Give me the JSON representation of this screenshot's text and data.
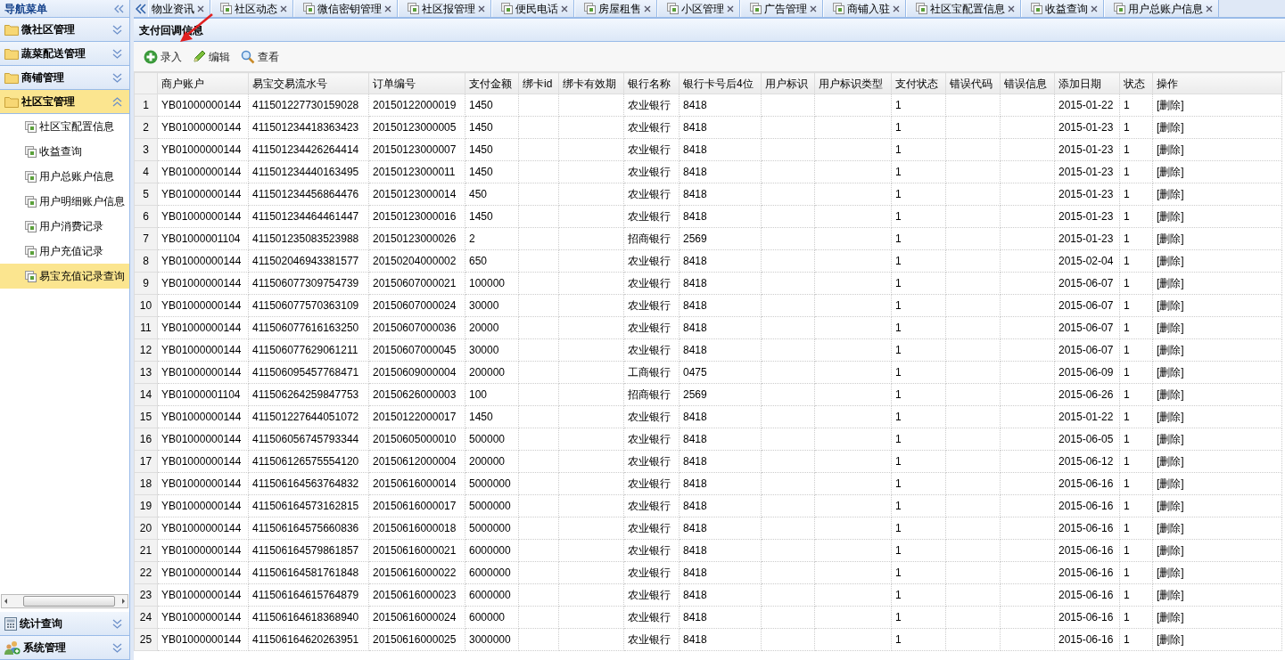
{
  "sidebar": {
    "title": "导航菜单",
    "sections": [
      {
        "label": "微社区管理",
        "kind": "folder",
        "expanded": false,
        "selected": false
      },
      {
        "label": "蔬菜配送管理",
        "kind": "folder",
        "expanded": false,
        "selected": false
      },
      {
        "label": "商铺管理",
        "kind": "folder",
        "expanded": false,
        "selected": false
      },
      {
        "label": "社区宝管理",
        "kind": "folder",
        "expanded": true,
        "selected": true,
        "items": [
          {
            "label": "社区宝配置信息",
            "selected": false
          },
          {
            "label": "收益查询",
            "selected": false
          },
          {
            "label": "用户总账户信息",
            "selected": false
          },
          {
            "label": "用户明细账户信息",
            "selected": false
          },
          {
            "label": "用户消费记录",
            "selected": false
          },
          {
            "label": "用户充值记录",
            "selected": false
          },
          {
            "label": "易宝充值记录查询",
            "selected": true
          }
        ]
      }
    ],
    "bottom_sections": [
      {
        "label": "统计查询",
        "kind": "calculator",
        "expanded": false
      },
      {
        "label": "系统管理",
        "kind": "users",
        "expanded": false
      }
    ]
  },
  "tabs": [
    {
      "label": "物业资讯",
      "kind": "cut",
      "selected": false
    },
    {
      "label": "社区动态",
      "kind": "page",
      "selected": false
    },
    {
      "label": "微信密钥管理",
      "kind": "page",
      "selected": false
    },
    {
      "label": "社区报管理",
      "kind": "page",
      "selected": false
    },
    {
      "label": "便民电话",
      "kind": "page",
      "selected": false
    },
    {
      "label": "房屋租售",
      "kind": "page",
      "selected": false
    },
    {
      "label": "小区管理",
      "kind": "page",
      "selected": false
    },
    {
      "label": "广告管理",
      "kind": "page",
      "selected": false
    },
    {
      "label": "商铺入驻",
      "kind": "page",
      "selected": false
    },
    {
      "label": "社区宝配置信息",
      "kind": "page",
      "selected": false
    },
    {
      "label": "收益查询",
      "kind": "page",
      "selected": false
    },
    {
      "label": "用户总账户信息",
      "kind": "page",
      "selected": false
    }
  ],
  "panel": {
    "title": "支付回调信息",
    "toolbar": [
      {
        "label": "录入",
        "kind": "add"
      },
      {
        "label": "编辑",
        "kind": "edit"
      },
      {
        "label": "查看",
        "kind": "view"
      }
    ],
    "table": {
      "columns": [
        "商户账户",
        "易宝交易流水号",
        "订单编号",
        "支付金额",
        "绑卡id",
        "绑卡有效期",
        "银行名称",
        "银行卡号后4位",
        "用户标识",
        "用户标识类型",
        "支付状态",
        "错误代码",
        "错误信息",
        "添加日期",
        "状态",
        "操作"
      ],
      "rows": [
        {
          "no": "1",
          "merchant_account": "YB01000000144",
          "serial_no": "411501227730159028",
          "order_no": "20150122000019",
          "amount": "1450",
          "bank": "农业银行",
          "card_last4": "8418",
          "pay_status": "1",
          "date": "2015-01-22",
          "status": "1",
          "action": "[删除]"
        },
        {
          "no": "2",
          "merchant_account": "YB01000000144",
          "serial_no": "411501234418363423",
          "order_no": "20150123000005",
          "amount": "1450",
          "bank": "农业银行",
          "card_last4": "8418",
          "pay_status": "1",
          "date": "2015-01-23",
          "status": "1",
          "action": "[删除]"
        },
        {
          "no": "3",
          "merchant_account": "YB01000000144",
          "serial_no": "411501234426264414",
          "order_no": "20150123000007",
          "amount": "1450",
          "bank": "农业银行",
          "card_last4": "8418",
          "pay_status": "1",
          "date": "2015-01-23",
          "status": "1",
          "action": "[删除]"
        },
        {
          "no": "4",
          "merchant_account": "YB01000000144",
          "serial_no": "411501234440163495",
          "order_no": "20150123000011",
          "amount": "1450",
          "bank": "农业银行",
          "card_last4": "8418",
          "pay_status": "1",
          "date": "2015-01-23",
          "status": "1",
          "action": "[删除]"
        },
        {
          "no": "5",
          "merchant_account": "YB01000000144",
          "serial_no": "411501234456864476",
          "order_no": "20150123000014",
          "amount": "450",
          "bank": "农业银行",
          "card_last4": "8418",
          "pay_status": "1",
          "date": "2015-01-23",
          "status": "1",
          "action": "[删除]"
        },
        {
          "no": "6",
          "merchant_account": "YB01000000144",
          "serial_no": "411501234464461447",
          "order_no": "20150123000016",
          "amount": "1450",
          "bank": "农业银行",
          "card_last4": "8418",
          "pay_status": "1",
          "date": "2015-01-23",
          "status": "1",
          "action": "[删除]"
        },
        {
          "no": "7",
          "merchant_account": "YB01000001104",
          "serial_no": "411501235083523988",
          "order_no": "20150123000026",
          "amount": "2",
          "bank": "招商银行",
          "card_last4": "2569",
          "pay_status": "1",
          "date": "2015-01-23",
          "status": "1",
          "action": "[删除]"
        },
        {
          "no": "8",
          "merchant_account": "YB01000000144",
          "serial_no": "411502046943381577",
          "order_no": "20150204000002",
          "amount": "650",
          "bank": "农业银行",
          "card_last4": "8418",
          "pay_status": "1",
          "date": "2015-02-04",
          "status": "1",
          "action": "[删除]"
        },
        {
          "no": "9",
          "merchant_account": "YB01000000144",
          "serial_no": "411506077309754739",
          "order_no": "20150607000021",
          "amount": "100000",
          "bank": "农业银行",
          "card_last4": "8418",
          "pay_status": "1",
          "date": "2015-06-07",
          "status": "1",
          "action": "[删除]"
        },
        {
          "no": "10",
          "merchant_account": "YB01000000144",
          "serial_no": "411506077570363109",
          "order_no": "20150607000024",
          "amount": "30000",
          "bank": "农业银行",
          "card_last4": "8418",
          "pay_status": "1",
          "date": "2015-06-07",
          "status": "1",
          "action": "[删除]"
        },
        {
          "no": "11",
          "merchant_account": "YB01000000144",
          "serial_no": "411506077616163250",
          "order_no": "20150607000036",
          "amount": "20000",
          "bank": "农业银行",
          "card_last4": "8418",
          "pay_status": "1",
          "date": "2015-06-07",
          "status": "1",
          "action": "[删除]"
        },
        {
          "no": "12",
          "merchant_account": "YB01000000144",
          "serial_no": "411506077629061211",
          "order_no": "20150607000045",
          "amount": "30000",
          "bank": "农业银行",
          "card_last4": "8418",
          "pay_status": "1",
          "date": "2015-06-07",
          "status": "1",
          "action": "[删除]"
        },
        {
          "no": "13",
          "merchant_account": "YB01000000144",
          "serial_no": "411506095457768471",
          "order_no": "20150609000004",
          "amount": "200000",
          "bank": "工商银行",
          "card_last4": "0475",
          "pay_status": "1",
          "date": "2015-06-09",
          "status": "1",
          "action": "[删除]"
        },
        {
          "no": "14",
          "merchant_account": "YB01000001104",
          "serial_no": "411506264259847753",
          "order_no": "20150626000003",
          "amount": "100",
          "bank": "招商银行",
          "card_last4": "2569",
          "pay_status": "1",
          "date": "2015-06-26",
          "status": "1",
          "action": "[删除]"
        },
        {
          "no": "15",
          "merchant_account": "YB01000000144",
          "serial_no": "411501227644051072",
          "order_no": "20150122000017",
          "amount": "1450",
          "bank": "农业银行",
          "card_last4": "8418",
          "pay_status": "1",
          "date": "2015-01-22",
          "status": "1",
          "action": "[删除]"
        },
        {
          "no": "16",
          "merchant_account": "YB01000000144",
          "serial_no": "411506056745793344",
          "order_no": "20150605000010",
          "amount": "500000",
          "bank": "农业银行",
          "card_last4": "8418",
          "pay_status": "1",
          "date": "2015-06-05",
          "status": "1",
          "action": "[删除]"
        },
        {
          "no": "17",
          "merchant_account": "YB01000000144",
          "serial_no": "411506126575554120",
          "order_no": "20150612000004",
          "amount": "200000",
          "bank": "农业银行",
          "card_last4": "8418",
          "pay_status": "1",
          "date": "2015-06-12",
          "status": "1",
          "action": "[删除]"
        },
        {
          "no": "18",
          "merchant_account": "YB01000000144",
          "serial_no": "411506164563764832",
          "order_no": "20150616000014",
          "amount": "5000000",
          "bank": "农业银行",
          "card_last4": "8418",
          "pay_status": "1",
          "date": "2015-06-16",
          "status": "1",
          "action": "[删除]"
        },
        {
          "no": "19",
          "merchant_account": "YB01000000144",
          "serial_no": "411506164573162815",
          "order_no": "20150616000017",
          "amount": "5000000",
          "bank": "农业银行",
          "card_last4": "8418",
          "pay_status": "1",
          "date": "2015-06-16",
          "status": "1",
          "action": "[删除]"
        },
        {
          "no": "20",
          "merchant_account": "YB01000000144",
          "serial_no": "411506164575660836",
          "order_no": "20150616000018",
          "amount": "5000000",
          "bank": "农业银行",
          "card_last4": "8418",
          "pay_status": "1",
          "date": "2015-06-16",
          "status": "1",
          "action": "[删除]"
        },
        {
          "no": "21",
          "merchant_account": "YB01000000144",
          "serial_no": "411506164579861857",
          "order_no": "20150616000021",
          "amount": "6000000",
          "bank": "农业银行",
          "card_last4": "8418",
          "pay_status": "1",
          "date": "2015-06-16",
          "status": "1",
          "action": "[删除]"
        },
        {
          "no": "22",
          "merchant_account": "YB01000000144",
          "serial_no": "411506164581761848",
          "order_no": "20150616000022",
          "amount": "6000000",
          "bank": "农业银行",
          "card_last4": "8418",
          "pay_status": "1",
          "date": "2015-06-16",
          "status": "1",
          "action": "[删除]"
        },
        {
          "no": "23",
          "merchant_account": "YB01000000144",
          "serial_no": "411506164615764879",
          "order_no": "20150616000023",
          "amount": "6000000",
          "bank": "农业银行",
          "card_last4": "8418",
          "pay_status": "1",
          "date": "2015-06-16",
          "status": "1",
          "action": "[删除]"
        },
        {
          "no": "24",
          "merchant_account": "YB01000000144",
          "serial_no": "411506164618368940",
          "order_no": "20150616000024",
          "amount": "600000",
          "bank": "农业银行",
          "card_last4": "8418",
          "pay_status": "1",
          "date": "2015-06-16",
          "status": "1",
          "action": "[删除]"
        },
        {
          "no": "25",
          "merchant_account": "YB01000000144",
          "serial_no": "411506164620263951",
          "order_no": "20150616000025",
          "amount": "3000000",
          "bank": "农业银行",
          "card_last4": "8418",
          "pay_status": "1",
          "date": "2015-06-16",
          "status": "1",
          "action": "[删除]"
        }
      ]
    }
  }
}
